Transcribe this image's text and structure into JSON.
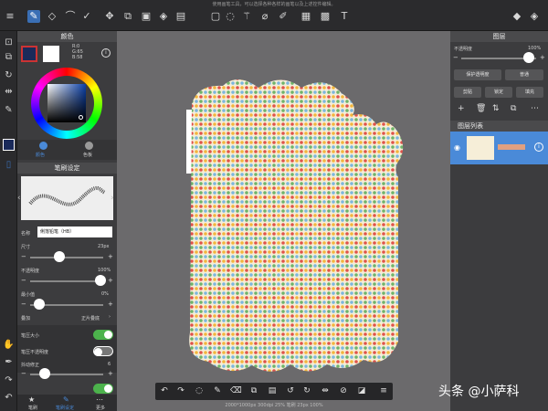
{
  "app": {
    "hint": "使用画笔工具，可以选择各种各样的画笔以及上述控件编辑。"
  },
  "toolbar": {
    "icons": [
      "menu-icon",
      "brush-tool-icon",
      "eraser-tool-icon",
      "smudge-tool-icon",
      "check-tool-icon",
      "move-tool-icon",
      "transform-tool-icon",
      "fill-tool-icon",
      "bucket-tool-icon",
      "gradient-tool-icon",
      "select-rect-icon",
      "select-lasso-icon",
      "magic-wand-icon",
      "eyedropper-icon",
      "select-pen-icon",
      "frame-icon",
      "grid-icon",
      "text-icon",
      "speech-icon",
      "layers-icon"
    ]
  },
  "color_panel": {
    "title": "颜色",
    "rgb": {
      "r": "R:0",
      "g": "G:65",
      "b": "B:58"
    },
    "tab_color": "颜色",
    "tab_palette": "色板"
  },
  "brush_panel": {
    "title": "笔刷设定",
    "name_label": "名称",
    "name_value": "俐落铅笔（HB）",
    "size_label": "尺寸",
    "size_value": "23px",
    "size_fraction": 0.33,
    "opacity_label": "不透明度",
    "opacity_value": "100%",
    "opacity_fraction": 0.98,
    "min_label": "最小值",
    "min_value": "0%",
    "min_fraction": 0.02,
    "blend_label": "叠加",
    "blend_value": "正片叠底",
    "pressure_size_label": "笔压大小",
    "pressure_size_on": true,
    "pressure_opacity_label": "笔压不透明度",
    "pressure_opacity_on": false,
    "correction_label": "抖动修正",
    "correction_value": "6",
    "correction_fraction": 0.18,
    "bottom_tabs": [
      "笔刷",
      "笔刷设定",
      "更多"
    ]
  },
  "layers_panel": {
    "title": "图层",
    "opacity_label": "不透明度",
    "opacity_value": "100%",
    "opacity_fraction": 0.95,
    "protect_alpha": "保护透明度",
    "blend_mode": "普通",
    "clip": "剪贴",
    "lock": "锁定",
    "fill": "填充",
    "list_title": "图层列表"
  },
  "status": {
    "text": "2000*1000px 300dpi 25% 笔刷 23px 100%"
  },
  "watermark": {
    "text": "头条 @小萨科"
  },
  "colors": {
    "accent": "#3a6fb5",
    "toggle_on": "#4cb34c",
    "panel": "#3c3c3e",
    "canvas_bg": "#6b6a6c",
    "fg": "#1a2a5a"
  }
}
